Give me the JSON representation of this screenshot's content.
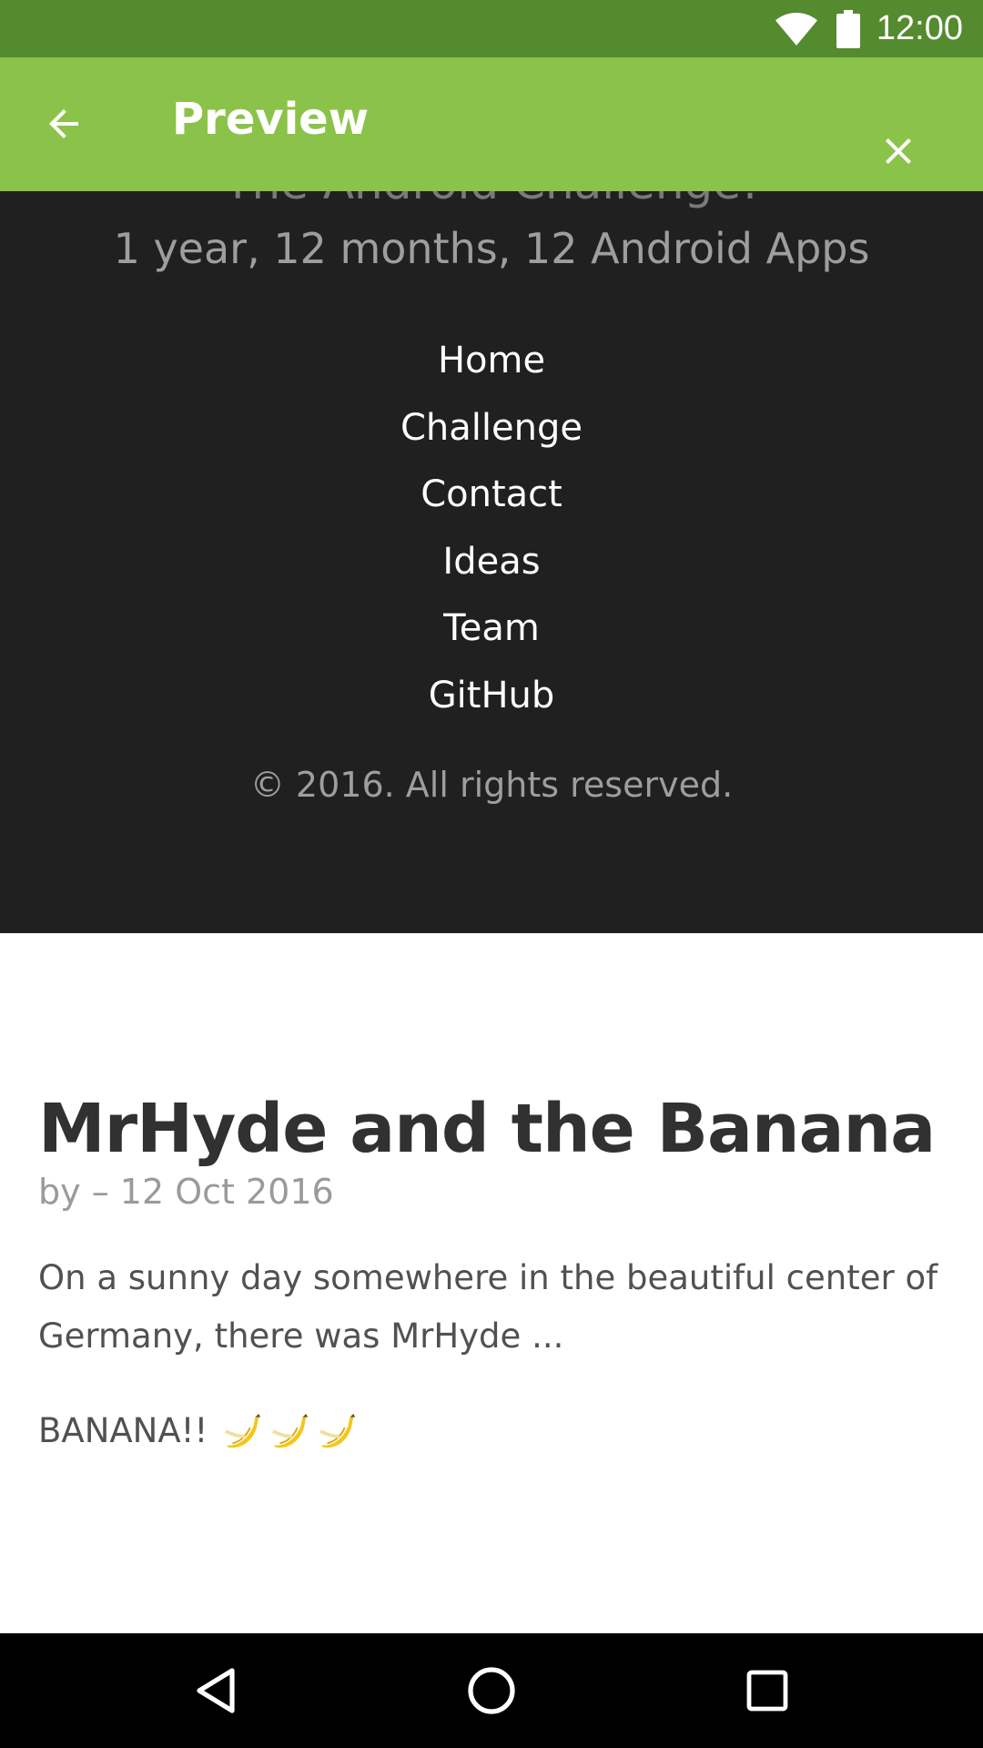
{
  "status_bar": {
    "time": "12:00",
    "icons": [
      "wifi-icon",
      "battery-icon"
    ]
  },
  "app_bar": {
    "title": "Preview",
    "back_icon": "arrow-back-icon",
    "close_icon": "close-icon",
    "color": "#8bc34a",
    "status_color": "#558b2f"
  },
  "site_header": {
    "site_title": "The Android Challenge!",
    "tagline": "1 year, 12 months, 12 Android Apps",
    "nav": [
      {
        "label": "Home"
      },
      {
        "label": "Challenge"
      },
      {
        "label": "Contact"
      },
      {
        "label": "Ideas"
      },
      {
        "label": "Team"
      },
      {
        "label": "GitHub"
      }
    ],
    "copyright": "© 2016. All rights reserved.",
    "background": "#202020"
  },
  "post": {
    "title": "MrHyde and the Banana",
    "meta": "by – 12 Oct 2016",
    "paragraph1": "On a sunny day somewhere in the beautiful center of Germany, there was MrHyde ...",
    "paragraph2": "BANANA!!",
    "emoji_icons": [
      "banana-icon",
      "banana-icon",
      "banana-icon"
    ]
  },
  "nav_bar": {
    "buttons": [
      "back-triangle-icon",
      "home-circle-icon",
      "recents-square-icon"
    ]
  }
}
